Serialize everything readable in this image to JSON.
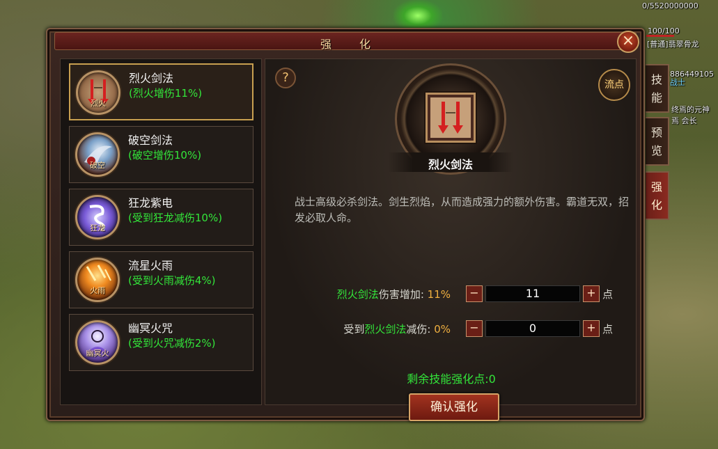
{
  "hud": {
    "exp": "0/5520000000",
    "hp": "100/100",
    "name": "[普通]翡翠骨龙",
    "id": "886449105",
    "class": "战士",
    "guild_line1": "终焉的元神",
    "guild_line2": "焉 会长"
  },
  "window": {
    "title": "强化",
    "close_label": "×"
  },
  "skills": [
    {
      "name": "烈火剑法",
      "bonus": "(烈火增伤11%)",
      "icon_label": "烈火"
    },
    {
      "name": "破空剑法",
      "bonus": "(破空增伤10%)",
      "icon_label": "破空"
    },
    {
      "name": "狂龙紫电",
      "bonus": "(受到狂龙减伤10%)",
      "icon_label": "狂龙"
    },
    {
      "name": "流星火雨",
      "bonus": "(受到火雨减伤4%)",
      "icon_label": "火雨"
    },
    {
      "name": "幽冥火咒",
      "bonus": "(受到火咒减伤2%)",
      "icon_label": "幽冥火"
    }
  ],
  "detail": {
    "help_label": "?",
    "flow_label": "流点",
    "skill_name": "烈火剑法",
    "description": "战士高级必杀剑法。剑生烈焰，从而造成强力的额外伤害。霸道无双，招发必取人命。",
    "stat1": {
      "skill": "烈火剑法",
      "text": "伤害增加:",
      "pct": "11%",
      "value": "11",
      "unit": "点"
    },
    "stat2": {
      "prefix": "受到",
      "skill": "烈火剑法",
      "text": "减伤:",
      "pct": "0%",
      "value": "0",
      "unit": "点"
    },
    "minus_label": "−",
    "plus_label": "+",
    "remaining": "剩余技能强化点:0",
    "confirm_label": "确认强化"
  },
  "side_tabs": [
    "技能",
    "预览",
    "强化"
  ],
  "colors": {
    "accent_green": "#33e63a",
    "frame_gold": "#c8a050",
    "button_red": "#a2331f"
  }
}
